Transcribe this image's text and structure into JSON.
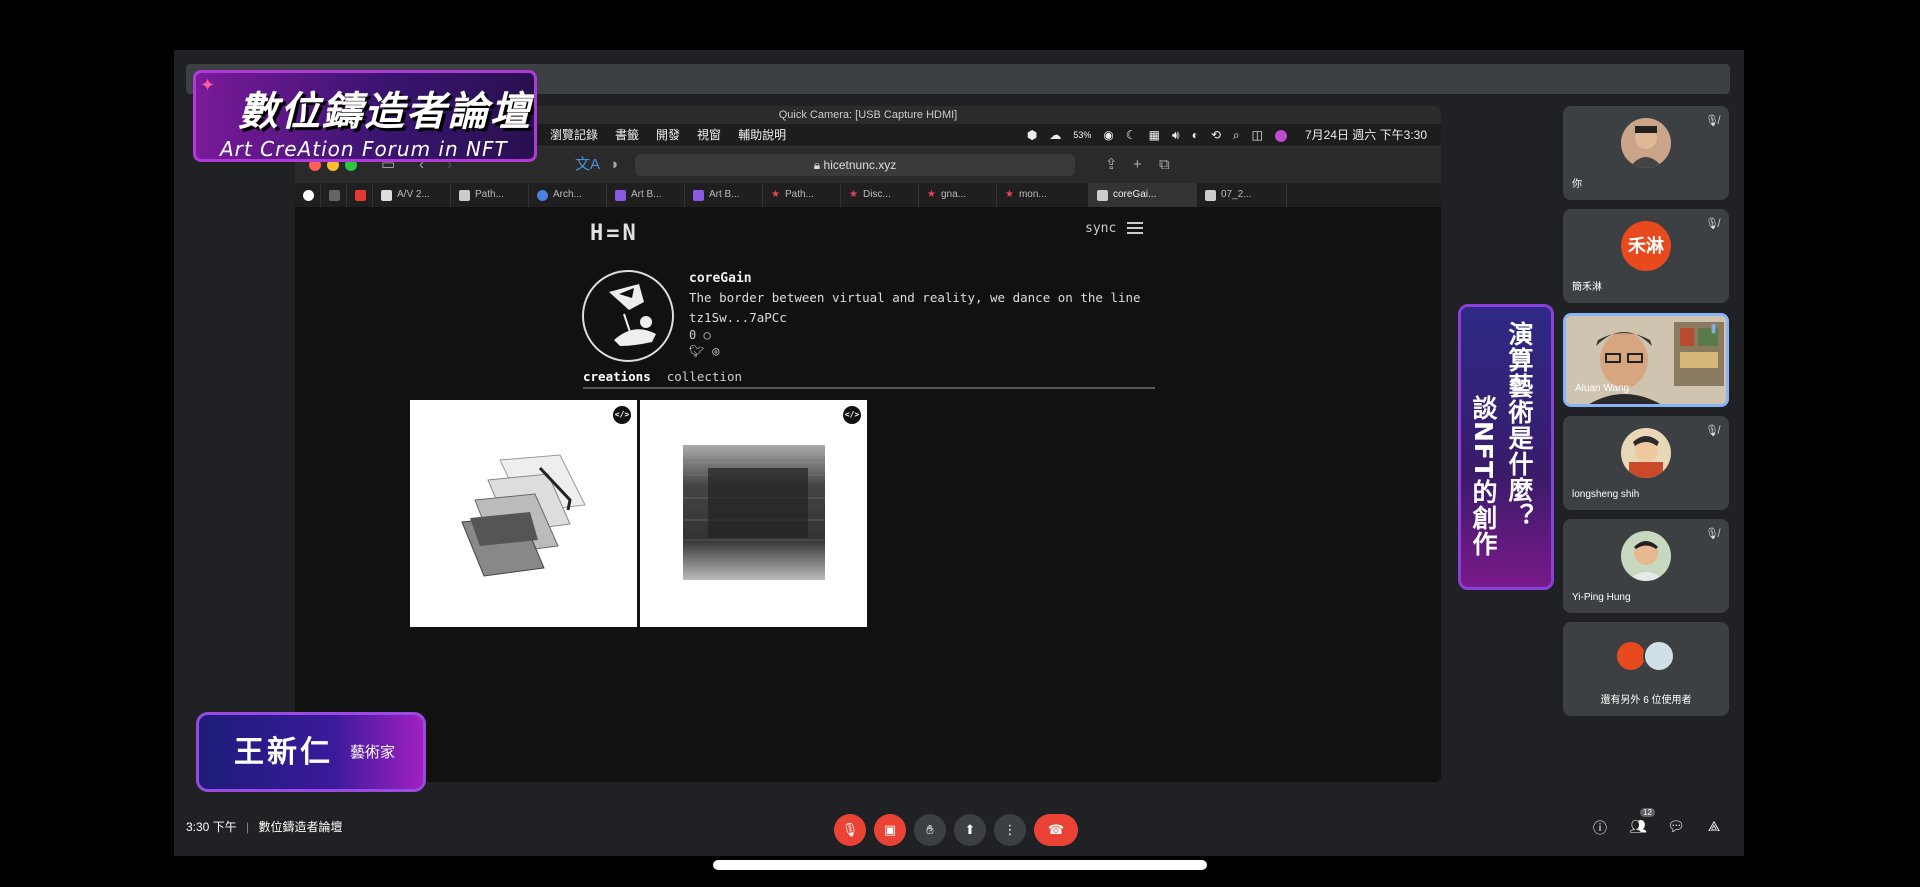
{
  "banner": {
    "title_cn": "數位鑄造者論壇",
    "title_en": "Art CreAtion Forum in NFT"
  },
  "window": {
    "title": "Quick Camera: [USB Capture HDMI]"
  },
  "menubar": {
    "items": [
      "瀏覽記錄",
      "書籤",
      "開發",
      "視窗",
      "輔助說明"
    ],
    "battery": "53%",
    "clock": "7月24日 週六 下午3:30"
  },
  "browser": {
    "url": "hicetnunc.xyz",
    "tabs": [
      {
        "label": "",
        "icon": "google-icon"
      },
      {
        "label": "",
        "icon": "a-icon"
      },
      {
        "label": "",
        "icon": "b-icon"
      },
      {
        "label": "A/V 2...",
        "icon": "v-icon"
      },
      {
        "label": "Path...",
        "icon": "hen-icon"
      },
      {
        "label": "Arch...",
        "icon": "arch-icon"
      },
      {
        "label": "Art B...",
        "icon": "grid-icon"
      },
      {
        "label": "Art B...",
        "icon": "grid-icon"
      },
      {
        "label": "Path...",
        "icon": "star-icon"
      },
      {
        "label": "Disc...",
        "icon": "star-icon"
      },
      {
        "label": "gna...",
        "icon": "star-icon"
      },
      {
        "label": "mon...",
        "icon": "star-icon"
      },
      {
        "label": "coreGai...",
        "icon": "hen-icon"
      },
      {
        "label": "07_2...",
        "icon": "hen-icon"
      }
    ]
  },
  "hen": {
    "logo": "H=N",
    "sync": "sync",
    "profile": {
      "name": "coreGain",
      "bio": "The border between virtual and reality, we dance on the line",
      "address": "tz1Sw...7aPCc",
      "count": "0 ○"
    },
    "tabs": {
      "creations": "creations",
      "collection": "collection"
    }
  },
  "participants": [
    {
      "name": "你"
    },
    {
      "name": "簡禾淋",
      "initials": "禾淋",
      "color": "#e8491d"
    },
    {
      "name": "Aluan Wang"
    },
    {
      "name": "longsheng shih"
    },
    {
      "name": "Yi-Ping Hung"
    },
    {
      "name": "還有另外 6 位使用者"
    }
  ],
  "overlay": {
    "line1": "演算藝術是什麼？",
    "line2": "談NFT的創作"
  },
  "speaker": {
    "name": "王新仁",
    "role": "藝術家"
  },
  "footer": {
    "time": "3:30 下午",
    "meeting": "數位鑄造者論壇",
    "people_count": "12"
  }
}
